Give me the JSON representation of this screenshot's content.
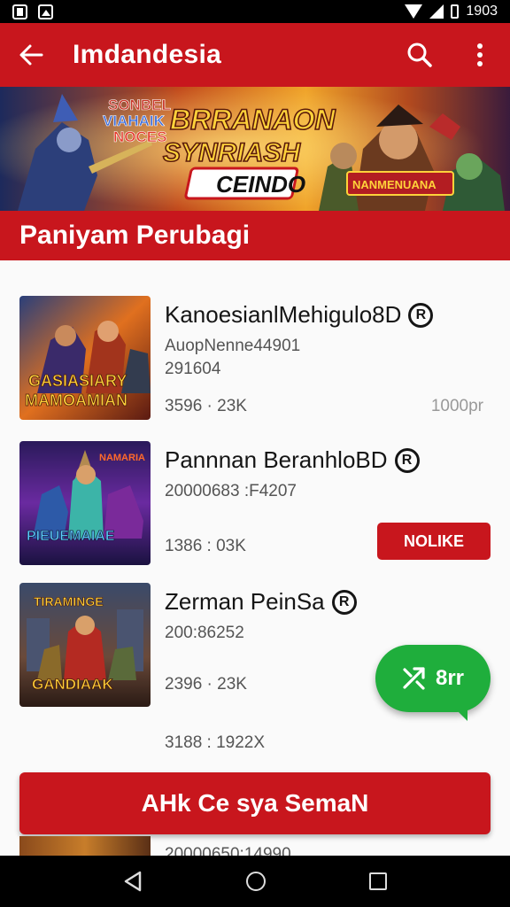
{
  "status_bar": {
    "time": "1903"
  },
  "app_bar": {
    "title": "Imdandesia"
  },
  "banner": {
    "title_line1": "BRRANAON",
    "title_line2": "SYNRIASH",
    "title_line3": "CEINDO",
    "left_text_line1": "SONBEL",
    "left_text_line2": "VIAHAIK",
    "left_text_line3": "NOCES",
    "badge_text": "NANMENUANA"
  },
  "section_header": {
    "title": "Paniyam Perubagi"
  },
  "items": [
    {
      "name": "KanoesianlMehigulo8D",
      "badge": "R",
      "subtitle": "AuopNenne44901",
      "code": "291604",
      "meta": "3596 · 23K",
      "right_meta": "1000pr",
      "thumb_text_line1": "GASIASIARY",
      "thumb_text_line2": "MAMOAMIAN"
    },
    {
      "name": "Pannnan BeranhloBD",
      "badge": "R",
      "subtitle": "20000683 :F4207",
      "meta": "1386 : 03K",
      "button_label": "NOLIKE",
      "thumb_text_line1": "NAMARIA",
      "thumb_text_line2": "PIEUEMAIAE"
    },
    {
      "name": "Zerman PeinSa",
      "badge": "R",
      "subtitle": "200:86252",
      "meta": "2396 · 23K",
      "thumb_text_line1": "TIRAMINGE",
      "thumb_text_line2": "GANDIAAK"
    }
  ],
  "extra_meta": "3188 : 1922X",
  "fab": {
    "label": "8rr"
  },
  "cta": {
    "label": "AHk Ce sya SemaN"
  },
  "peek_text": "20000650:14990"
}
